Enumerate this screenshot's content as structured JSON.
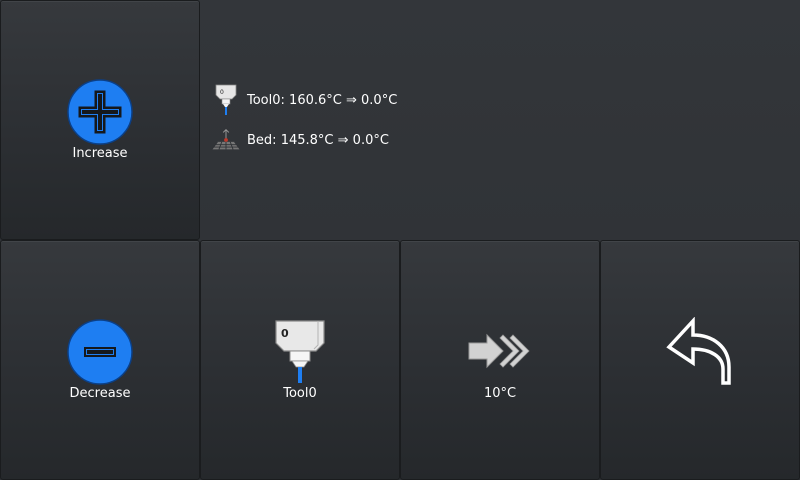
{
  "buttons": {
    "increase": {
      "label": "Increase",
      "icon": "plus-circle-icon"
    },
    "decrease": {
      "label": "Decrease",
      "icon": "minus-circle-icon"
    },
    "tool": {
      "label": "Tool0",
      "icon": "extruder-icon",
      "icon_number": "0"
    },
    "step": {
      "label": "10°C",
      "icon": "increment-arrows-icon"
    },
    "back": {
      "icon": "back-arrow-icon"
    }
  },
  "temperatures": {
    "tool": {
      "name": "Tool0",
      "current": "160.6°C",
      "target": "0.0°C",
      "arrow": "⇒",
      "icon_number": "0"
    },
    "bed": {
      "name": "Bed",
      "current": "145.8°C",
      "target": "0.0°C",
      "arrow": "⇒"
    }
  },
  "colors": {
    "accent_blue": "#1e7ef2",
    "background": "#2f3236"
  }
}
